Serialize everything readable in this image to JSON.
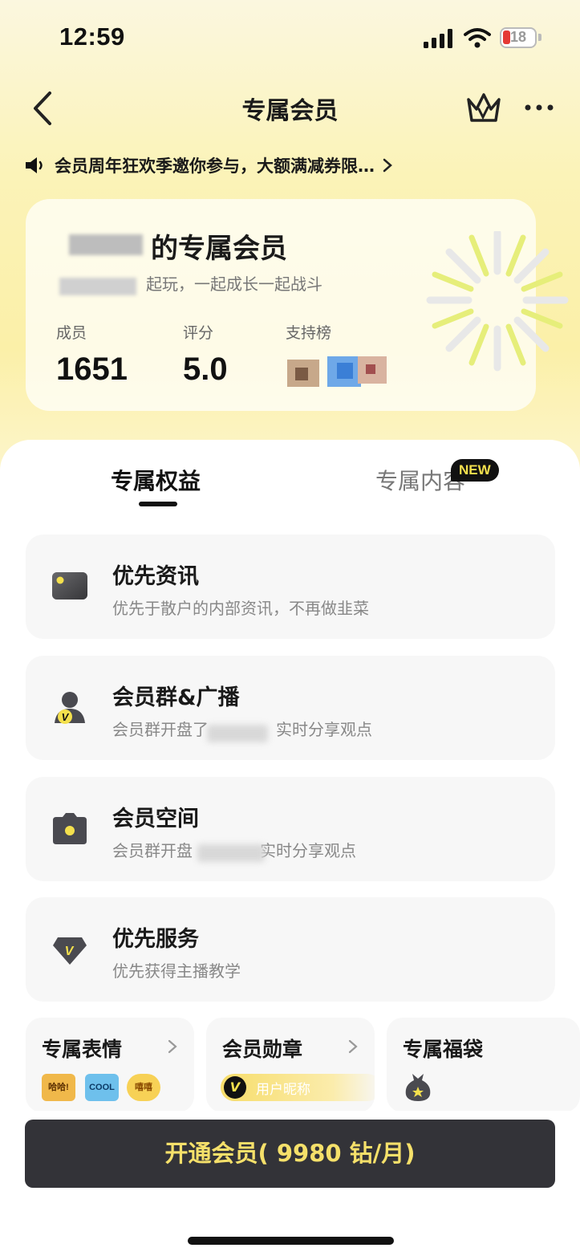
{
  "status_bar": {
    "time": "12:59",
    "battery": "18"
  },
  "nav": {
    "title": "专属会员"
  },
  "announcement": {
    "text": "会员周年狂欢季邀你参与，大额满减券限…"
  },
  "member_card": {
    "title_visible": "的专属会员",
    "subtitle_visible": "起玩，一起成长一起战斗",
    "stats": [
      {
        "label": "成员",
        "value": "1651"
      },
      {
        "label": "评分",
        "value": "5.0"
      },
      {
        "label": "支持榜",
        "value": ""
      }
    ]
  },
  "tabs": [
    {
      "label": "专属权益",
      "active": true
    },
    {
      "label": "专属内容",
      "active": false,
      "badge": "NEW"
    }
  ],
  "benefits": [
    {
      "icon": "card-icon",
      "title": "优先资讯",
      "desc": "优先于散户的内部资讯，不再做韭菜"
    },
    {
      "icon": "member-group-icon",
      "title": "会员群&广播",
      "desc": "会员群开盘了",
      "desc_tail": "实时分享观点"
    },
    {
      "icon": "camera-icon",
      "title": "会员空间",
      "desc": "会员群开盘",
      "desc_tail": "实时分享观点"
    },
    {
      "icon": "diamond-v-icon",
      "title": "优先服务",
      "desc": "优先获得主播教学"
    }
  ],
  "mini_cards": [
    {
      "title": "专属表情",
      "stickers": [
        "哈哈!",
        "COOL",
        "嘻嘻"
      ]
    },
    {
      "title": "会员勋章",
      "badge_text": "用户昵称"
    },
    {
      "title": "专属福袋"
    }
  ],
  "cta": {
    "label": "开通会员( 9980 钻/月)"
  },
  "colors": {
    "accent_yellow": "#f5e06a",
    "cta_bg": "#333338",
    "header_bg": "#fbf3b8"
  }
}
